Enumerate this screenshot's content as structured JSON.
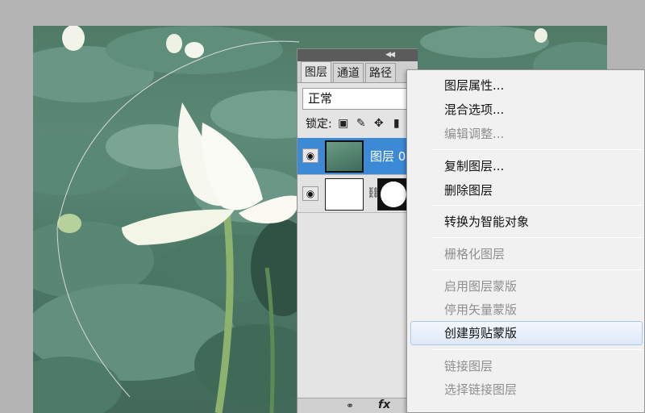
{
  "panel": {
    "tabs": [
      "图层",
      "通道",
      "路径"
    ],
    "blend_mode": "正常",
    "lock_label": "锁定:",
    "lock_icons": [
      "lock-transparent-icon",
      "lock-brush-icon",
      "lock-move-icon",
      "lock-all-icon"
    ],
    "layers": [
      {
        "name": "图层 0",
        "selected": true,
        "visible": true
      },
      {
        "name": "",
        "selected": false,
        "visible": true,
        "has_mask": true
      }
    ],
    "bottom_icons": [
      "link-icon",
      "fx-icon"
    ],
    "titlebar_icons": [
      "collapse-icon",
      "close-icon"
    ]
  },
  "context_menu": {
    "items": [
      {
        "label": "图层属性...",
        "enabled": true
      },
      {
        "label": "混合选项...",
        "enabled": true
      },
      {
        "label": "编辑调整...",
        "enabled": false
      },
      {
        "label": "复制图层...",
        "enabled": true
      },
      {
        "label": "删除图层",
        "enabled": true
      },
      {
        "label": "转换为智能对象",
        "enabled": true
      },
      {
        "label": "栅格化图层",
        "enabled": false
      },
      {
        "label": "启用图层蒙版",
        "enabled": false
      },
      {
        "label": "停用矢量蒙版",
        "enabled": false
      },
      {
        "label": "创建剪贴蒙版",
        "enabled": true,
        "highlighted": true
      },
      {
        "label": "链接图层",
        "enabled": false
      },
      {
        "label": "选择链接图层",
        "enabled": false
      }
    ]
  },
  "colors": {
    "selection_blue": "#3c8ad6",
    "menu_bg": "#f1f1f1",
    "disabled_text": "#8f8f8f"
  }
}
